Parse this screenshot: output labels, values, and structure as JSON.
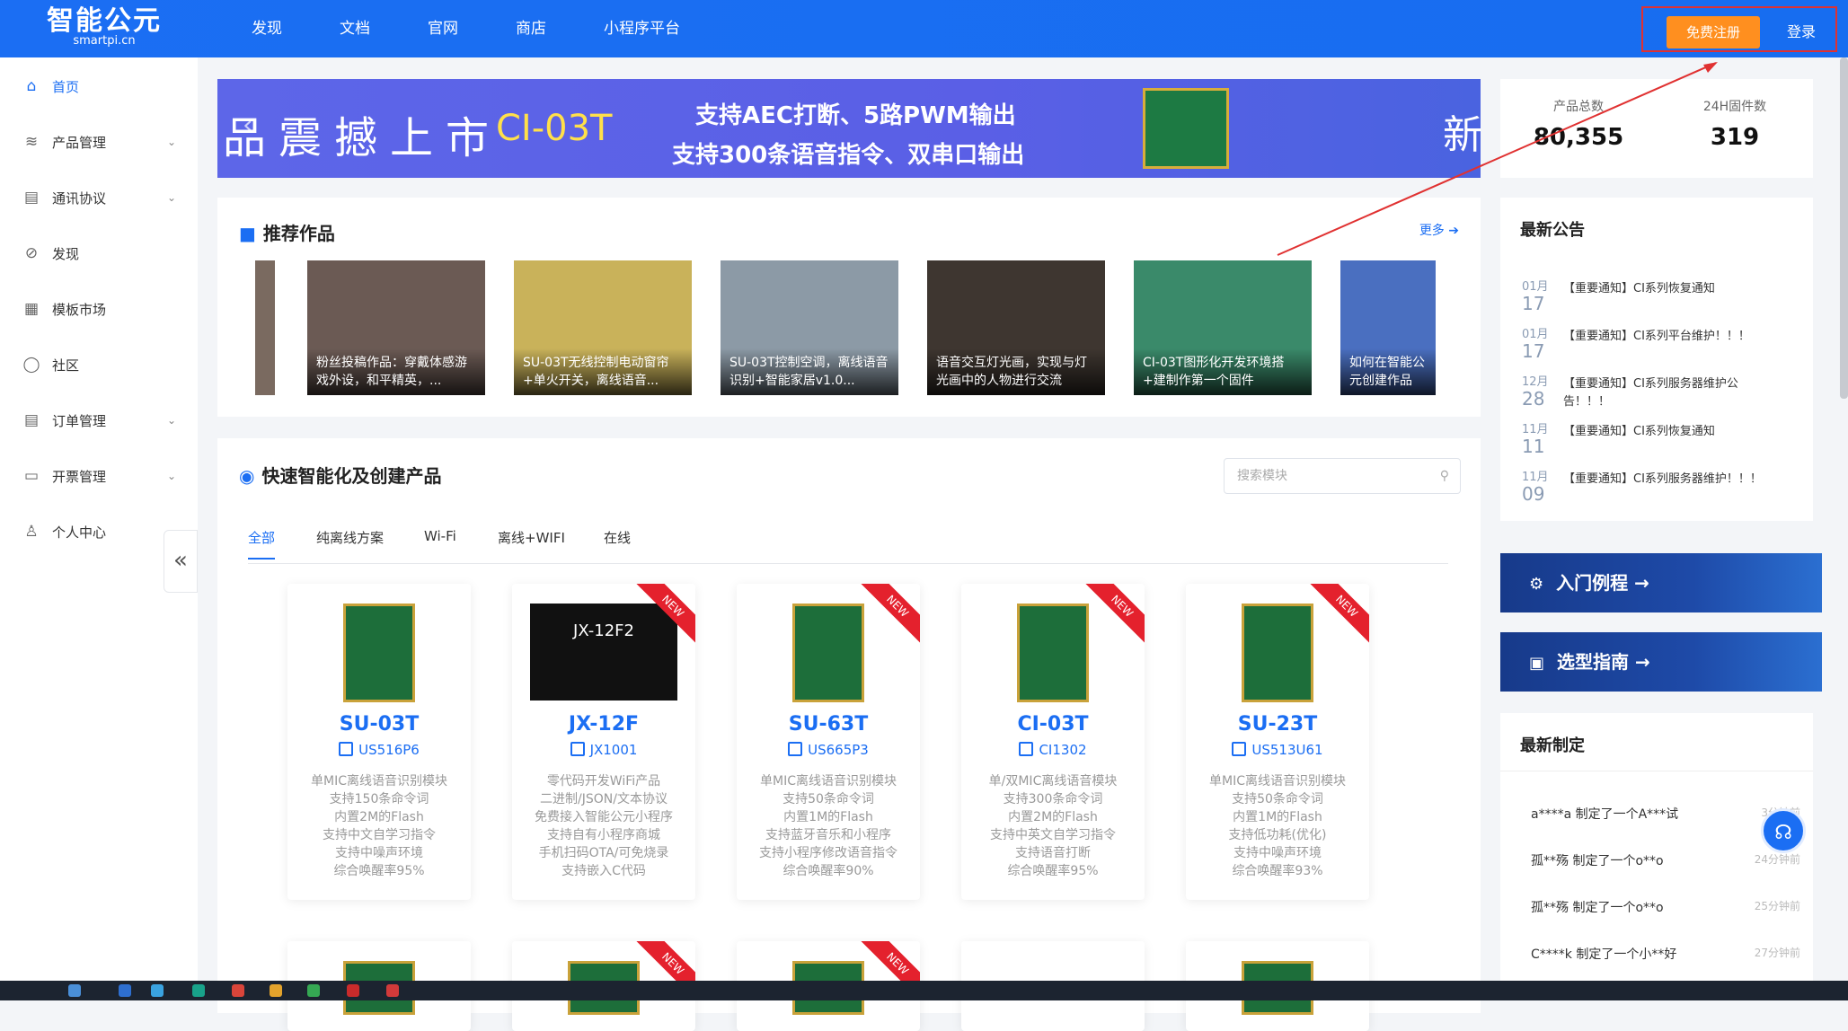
{
  "header": {
    "logo_text": "智能公元",
    "logo_sub": "smartpi.cn",
    "nav": [
      "发现",
      "文档",
      "官网",
      "商店",
      "小程序平台"
    ],
    "register": "免费注册",
    "login": "登录"
  },
  "sidebar": {
    "items": [
      {
        "label": "首页",
        "icon": "home-icon",
        "chevron": false
      },
      {
        "label": "产品管理",
        "icon": "layers-icon",
        "chevron": true
      },
      {
        "label": "通讯协议",
        "icon": "protocol-icon",
        "chevron": true
      },
      {
        "label": "发现",
        "icon": "compass-icon",
        "chevron": false
      },
      {
        "label": "模板市场",
        "icon": "template-icon",
        "chevron": false
      },
      {
        "label": "社区",
        "icon": "chat-icon",
        "chevron": false
      },
      {
        "label": "订单管理",
        "icon": "order-icon",
        "chevron": true
      },
      {
        "label": "开票管理",
        "icon": "invoice-icon",
        "chevron": true
      },
      {
        "label": "个人中心",
        "icon": "user-icon",
        "chevron": true
      }
    ],
    "collapse_glyph": "«"
  },
  "banner": {
    "left_text": "品震撼上市",
    "model": "CI-03T",
    "line1": "支持AEC打断、5路PWM输出",
    "line2": "支持300条语音指令、双串口输出",
    "right_text": "新"
  },
  "stats": {
    "total_label": "产品总数",
    "total_value": "80,355",
    "firmware_label": "24H固件数",
    "firmware_value": "319"
  },
  "recommended": {
    "title": "推荐作品",
    "more": "更多",
    "cards": [
      {
        "caption": "粉丝投稿作品：穿戴体感游戏外设，和平精英，...",
        "color": "#6b5a54"
      },
      {
        "caption": "SU-03T无线控制电动窗帘+单火开关，离线语音...",
        "color": "#c9b25a"
      },
      {
        "caption": "SU-03T控制空调，离线语音识别+智能家居v1.0...",
        "color": "#8c9aa6"
      },
      {
        "caption": "语音交互灯光画，实现与灯光画中的人物进行交流",
        "color": "#3e3630"
      },
      {
        "caption": "CI-03T图形化开发环境搭+建制作第一个固件",
        "color": "#3a8a6a"
      },
      {
        "caption": "如何在智能公元创建作品——",
        "color": "#4a6fc0"
      }
    ]
  },
  "products": {
    "title": "快速智能化及创建产品",
    "search_placeholder": "搜索模块",
    "tabs": [
      "全部",
      "纯离线方案",
      "Wi-Fi",
      "离线+WIFI",
      "在线"
    ],
    "new_label": "NEW",
    "items": [
      {
        "name": "SU-03T",
        "chip": "US516P6",
        "new": false,
        "desc": [
          "单MIC离线语音识别模块",
          "支持150条命令词",
          "内置2M的Flash",
          "支持中文自学习指令",
          "支持中噪声环境",
          "综合唤醒率95%"
        ]
      },
      {
        "name": "JX-12F",
        "chip": "JX1001",
        "new": true,
        "img_text": "JX-12F2",
        "desc": [
          "零代码开发WiFi产品",
          "二进制/JSON/文本协议",
          "免费接入智能公元小程序",
          "支持自有小程序商城",
          "手机扫码OTA/可免烧录",
          "支持嵌入C代码"
        ]
      },
      {
        "name": "SU-63T",
        "chip": "US665P3",
        "new": true,
        "desc": [
          "单MIC离线语音识别模块",
          "支持50条命令词",
          "内置1M的Flash",
          "支持蓝牙音乐和小程序",
          "支持小程序修改语音指令",
          "综合唤醒率90%"
        ]
      },
      {
        "name": "CI-03T",
        "chip": "CI1302",
        "new": true,
        "desc": [
          "单/双MIC离线语音模块",
          "支持300条命令词",
          "内置2M的Flash",
          "支持中英文自学习指令",
          "支持语音打断",
          "综合唤醒率95%"
        ]
      },
      {
        "name": "SU-23T",
        "chip": "US513U61",
        "new": true,
        "desc": [
          "单MIC离线语音识别模块",
          "支持50条命令词",
          "内置1M的Flash",
          "支持低功耗(优化)",
          "支持中噪声环境",
          "综合唤醒率93%"
        ]
      }
    ]
  },
  "notices": {
    "title": "最新公告",
    "items": [
      {
        "month": "01月",
        "day": "17",
        "text": "【重要通知】CI系列恢复通知"
      },
      {
        "month": "01月",
        "day": "17",
        "text": "【重要通知】CI系列平台维护！！！"
      },
      {
        "month": "12月",
        "day": "28",
        "text": "【重要通知】CI系列服务器维护公告！！！"
      },
      {
        "month": "11月",
        "day": "11",
        "text": "【重要通知】CI系列恢复通知"
      },
      {
        "month": "11月",
        "day": "09",
        "text": "【重要通知】CI系列服务器维护！！！"
      }
    ]
  },
  "quick_links": {
    "tutorial": "入门例程 →",
    "guide": "选型指南 →"
  },
  "latest": {
    "title": "最新制定",
    "items": [
      {
        "text": "a****a 制定了一个A***试",
        "time": "3分钟前"
      },
      {
        "text": "孤**殇 制定了一个o**o",
        "time": "24分钟前"
      },
      {
        "text": "孤**殇 制定了一个o**o",
        "time": "25分钟前"
      },
      {
        "text": "C****k 制定了一个小**好",
        "time": "27分钟前"
      }
    ]
  },
  "colors": {
    "primary": "#1b6ef3",
    "register": "#ff8f1f",
    "highlight_border": "#e03131",
    "new_ribbon": "#e4212d"
  }
}
